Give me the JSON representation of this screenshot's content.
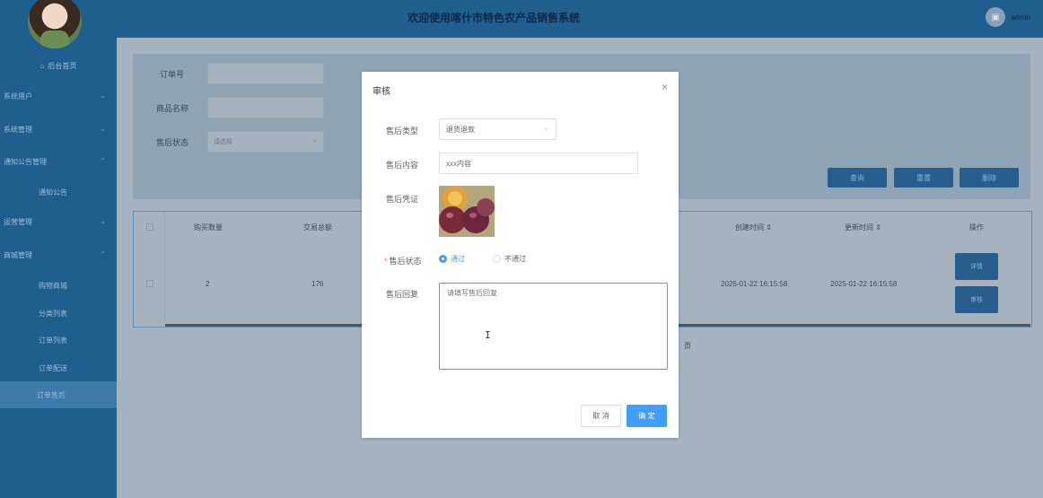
{
  "header": {
    "title": "欢迎使用喀什市特色农产品销售系统",
    "username": "admin"
  },
  "sidebar": {
    "home": "后台首页",
    "items": [
      {
        "label": "系统用户"
      },
      {
        "label": "系统管理"
      },
      {
        "label": "通知公告管理"
      },
      {
        "label": "通知公告"
      },
      {
        "label": "运营管理"
      },
      {
        "label": "商城管理"
      },
      {
        "label": "购物商城"
      },
      {
        "label": "分类列表"
      },
      {
        "label": "订单列表"
      },
      {
        "label": "订单配送"
      },
      {
        "label": "订单售后"
      }
    ]
  },
  "filters": {
    "order_no_label": "订单号",
    "product_name_label": "商品名称",
    "status_label": "售后状态",
    "status_placeholder": "请选择",
    "query": "查询",
    "reset": "重置",
    "delete": "删除"
  },
  "table": {
    "headers": [
      "购买数量",
      "交易总额",
      "创建时间 ⇕",
      "更新时间 ⇕",
      "操作"
    ],
    "row": {
      "qty": "2",
      "total": "176",
      "created": "2025-01-22 16:15:58",
      "updated": "2025-01-22 16:15:58",
      "detail": "详情",
      "review": "审核"
    },
    "pager_suffix": "页"
  },
  "modal": {
    "title": "审核",
    "close": "×",
    "type_label": "售后类型",
    "type_value": "退货退款",
    "content_label": "售后内容",
    "content_value": "xxx内容",
    "proof_label": "售后凭证",
    "status_label": "售后状态",
    "status_options": [
      "通过",
      "不通过"
    ],
    "reply_label": "售后回复",
    "reply_placeholder": "请填写售后回复",
    "cancel": "取 消",
    "confirm": "确 定"
  },
  "colors": {
    "accent": "#409eff",
    "sidebar": "#1f5f8f",
    "required": "#f56c6c"
  }
}
